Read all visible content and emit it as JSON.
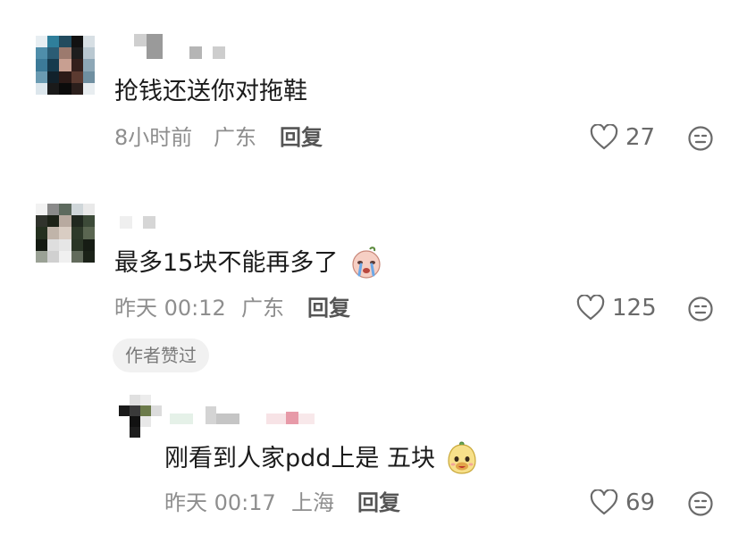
{
  "comments": [
    {
      "text": "抢钱还送你对拖鞋",
      "time": "8小时前",
      "location": "广东",
      "reply_label": "回复",
      "likes": "27"
    },
    {
      "text": "最多15块不能再多了",
      "time": "昨天 00:12",
      "location": "广东",
      "reply_label": "回复",
      "likes": "125",
      "badge": "作者赞过",
      "emoji": "crying-face-emoji"
    },
    {
      "text": "刚看到人家pdd上是 五块",
      "time": "昨天 00:17",
      "location": "上海",
      "reply_label": "回复",
      "likes": "69",
      "emoji": "happy-face-emoji"
    }
  ],
  "icons": {
    "like": "heart-outline-icon",
    "dislike": "meh-face-icon"
  },
  "colors": {
    "meta": "#8e8e8e",
    "icon": "#6a6a6a",
    "badge_bg": "#f1f1f1"
  }
}
